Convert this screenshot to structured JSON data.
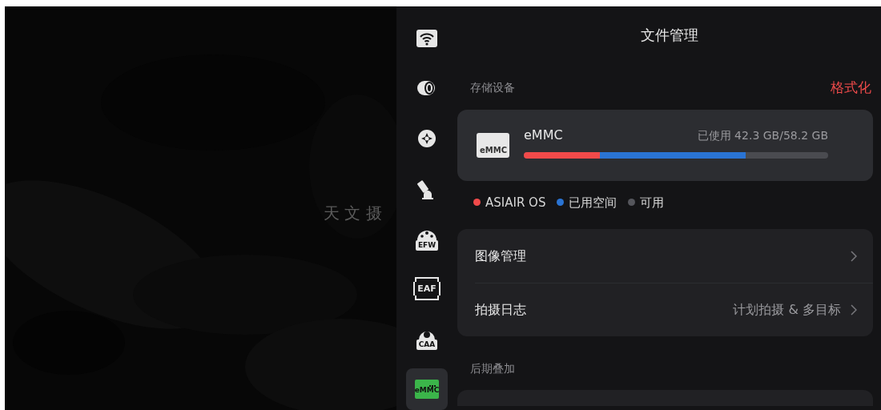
{
  "background": {
    "caption": "天 文 摄"
  },
  "sidebar": {
    "items": [
      {
        "kind": "wifi",
        "selected": false
      },
      {
        "kind": "camera",
        "selected": false
      },
      {
        "kind": "guide",
        "selected": false
      },
      {
        "kind": "mount",
        "selected": false
      },
      {
        "kind": "filter-wheel",
        "label": "EFW",
        "selected": false
      },
      {
        "kind": "focuser",
        "label": "EAF",
        "selected": false
      },
      {
        "kind": "rotator",
        "label": "CAA",
        "selected": false
      },
      {
        "kind": "storage",
        "label": "eMMC",
        "selected": true
      }
    ]
  },
  "title": "文件管理",
  "storage": {
    "heading": "存储设备",
    "action": "格式化",
    "device": {
      "icon_label": "eMMC",
      "name": "eMMC",
      "usage": "已使用 42.3 GB/58.2 GB",
      "segments": [
        {
          "level": 0.25,
          "color": "#f04a4a"
        },
        {
          "level": 0.48,
          "color": "#2a74d4"
        }
      ]
    },
    "legend": [
      {
        "label": "ASIAIR OS",
        "color": "#f04a4a"
      },
      {
        "label": "已用空间",
        "color": "#2a74d4"
      },
      {
        "label": "可用",
        "color": "#55565c"
      }
    ]
  },
  "menu": [
    {
      "label": "图像管理"
    },
    {
      "label": "拍摄日志",
      "value": "计划拍摄 & 多目标"
    }
  ],
  "stacking": {
    "heading": "后期叠加"
  }
}
